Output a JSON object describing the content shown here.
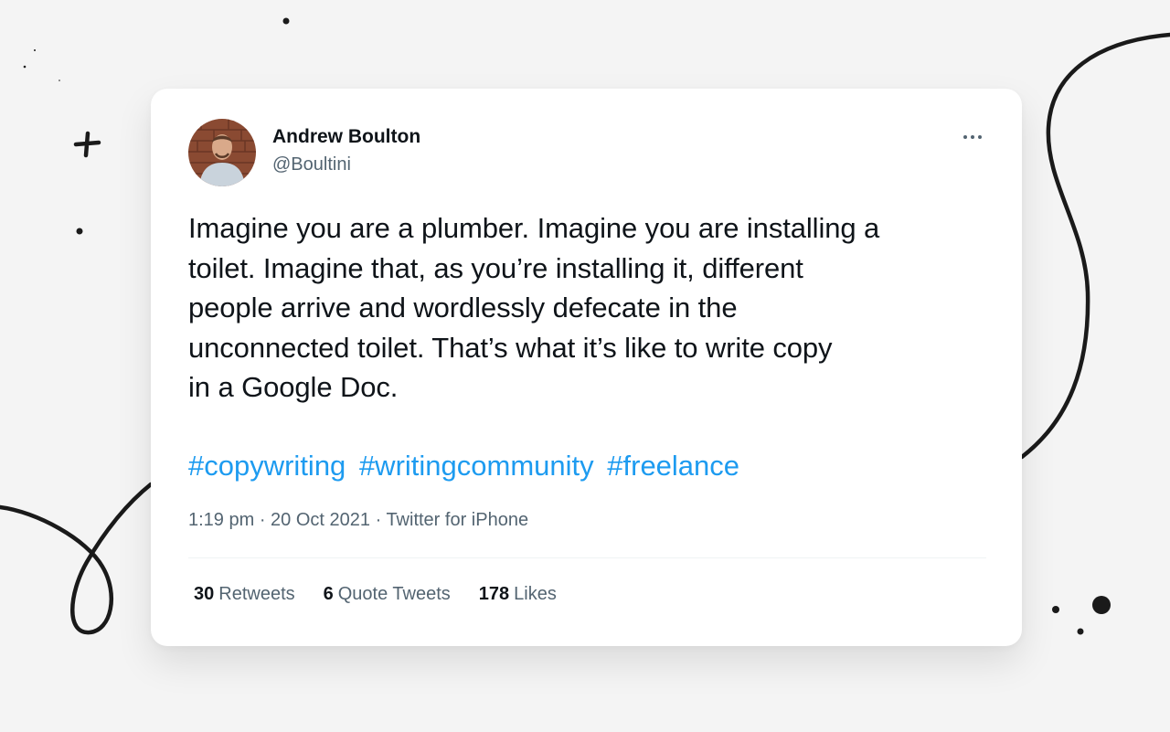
{
  "tweet": {
    "author": {
      "name": "Andrew Boulton",
      "handle": "@Boultini"
    },
    "more_icon": "ellipsis-icon",
    "text_lines": [
      "Imagine you are a plumber. Imagine you are installing a",
      "toilet. Imagine that, as you’re installing it, different",
      "people arrive and wordlessly defecate in the",
      "unconnected toilet. That’s what it’s like to write copy",
      "in a Google Doc."
    ],
    "hashtags": [
      "#copywriting",
      "#writingcommunity",
      "#freelance"
    ],
    "meta": {
      "time": "1:19 pm",
      "separator": "·",
      "date": "20 Oct 2021",
      "source": "Twitter for iPhone"
    },
    "stats": {
      "retweets_count": "30",
      "retweets_label": "Retweets",
      "quotes_count": "6",
      "quotes_label": "Quote Tweets",
      "likes_count": "178",
      "likes_label": "Likes"
    }
  },
  "colors": {
    "background": "#f4f4f4",
    "card": "#ffffff",
    "text": "#0f1419",
    "secondary_text": "#536471",
    "hashtag": "#1d9bf0",
    "decoration": "#1a1a1a"
  }
}
